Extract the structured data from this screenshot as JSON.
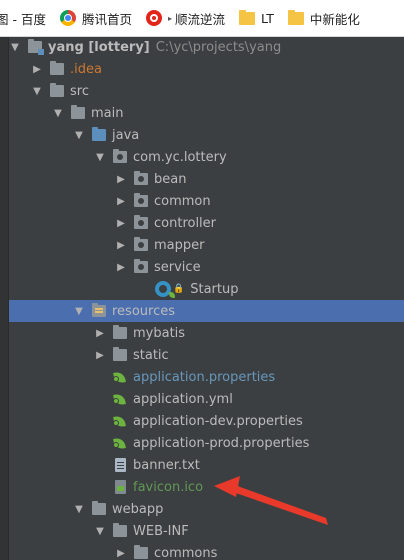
{
  "bookmarks": [
    {
      "label": "图 - 百度",
      "icon": "none"
    },
    {
      "label": "腾讯首页",
      "icon": "chrome-icon"
    },
    {
      "label": "顺流逆流",
      "icon": "circle-icon",
      "prefix": "▸"
    },
    {
      "label": "LT",
      "icon": "folder-icon"
    },
    {
      "label": "中新能化",
      "icon": "folder-icon"
    }
  ],
  "tree": {
    "project_name": "yang [lottery]",
    "project_path": "C:\\yc\\projects\\yang",
    "idea": ".idea",
    "src": "src",
    "main": "main",
    "java": "java",
    "package": "com.yc.lottery",
    "bean": "bean",
    "common": "common",
    "controller": "controller",
    "mapper": "mapper",
    "service": "service",
    "startup": "Startup",
    "resources": "resources",
    "mybatis": "mybatis",
    "static": "static",
    "application_properties": "application.properties",
    "application_yml": "application.yml",
    "application_dev": "application-dev.properties",
    "application_prod": "application-prod.properties",
    "banner": "banner.txt",
    "favicon": "favicon.ico",
    "webapp": "webapp",
    "webinf": "WEB-INF",
    "commons": "commons"
  },
  "colors": {
    "background": "#3c3f41",
    "selection": "#4b6eaf",
    "annotation_arrow": "#e8392b",
    "excluded_folder": "#cc7832",
    "modified_file": "#6897bb",
    "new_file": "#629755"
  }
}
